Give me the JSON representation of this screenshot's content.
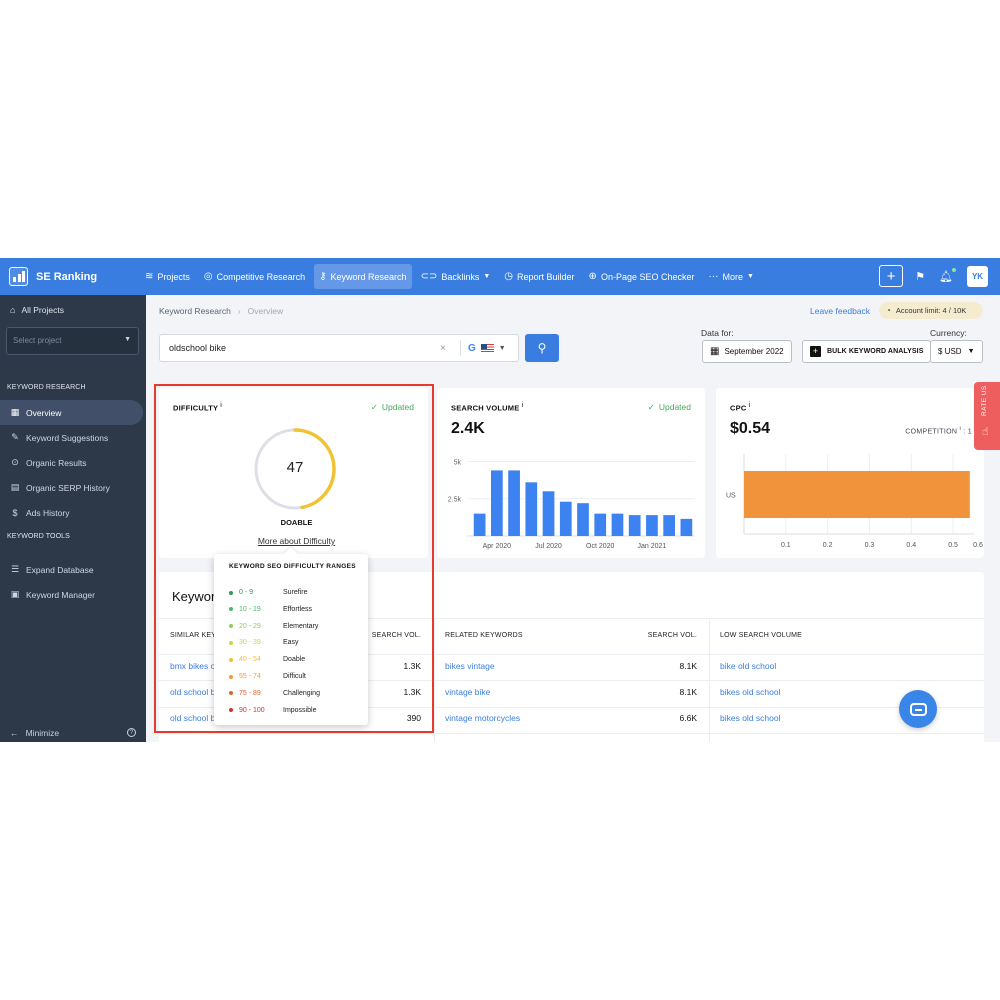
{
  "topbar": {
    "brand": "SE Ranking",
    "nav": [
      {
        "label": "Projects",
        "icon": "layers-icon"
      },
      {
        "label": "Competitive Research",
        "icon": "target-icon"
      },
      {
        "label": "Keyword Research",
        "icon": "key-icon"
      },
      {
        "label": "Backlinks",
        "icon": "link-icon"
      },
      {
        "label": "Report Builder",
        "icon": "clock-icon"
      },
      {
        "label": "On-Page SEO Checker",
        "icon": "search-icon"
      },
      {
        "label": "More",
        "icon": "dots-icon"
      }
    ],
    "avatar": "YK"
  },
  "sidebar": {
    "all_projects": "All Projects",
    "select_placeholder": "Select project",
    "section_research": "KEYWORD RESEARCH",
    "research_items": [
      "Overview",
      "Keyword Suggestions",
      "Organic Results",
      "Organic SERP History",
      "Ads History"
    ],
    "section_tools": "KEYWORD TOOLS",
    "tool_items": [
      "Expand Database",
      "Keyword Manager"
    ],
    "minimize": "Minimize"
  },
  "header": {
    "crumb_1": "Keyword Research",
    "crumb_2": "Overview",
    "feedback": "Leave feedback",
    "account_limit": "Account limit: 4 / 10K",
    "search_value": "oldschool bike",
    "data_for_label": "Data for:",
    "date_button": "September 2022",
    "bulk_button": "BULK KEYWORD ANALYSIS",
    "currency_label": "Currency:",
    "currency_value": "$ USD"
  },
  "difficulty": {
    "title": "DIFFICULTY",
    "status": "Updated",
    "value": "47",
    "score": 47,
    "label": "DOABLE",
    "more_link": "More about Difficulty"
  },
  "search_volume": {
    "title": "SEARCH VOLUME",
    "status": "Updated",
    "value": "2.4K"
  },
  "cpc": {
    "title": "CPC",
    "value": "$0.54",
    "competition_label": "COMPETITION",
    "competition_value": "1"
  },
  "chart_data": [
    {
      "type": "bar",
      "categories": [
        "",
        "",
        "",
        "",
        "",
        "",
        "",
        "",
        "",
        "",
        "",
        "",
        ""
      ],
      "values": [
        1500,
        4400,
        4400,
        3600,
        3000,
        2300,
        2200,
        1500,
        1500,
        1400,
        1400,
        1400,
        1150
      ],
      "x_tick_labels": [
        "Apr 2020",
        "Jul 2020",
        "Oct 2020",
        "Jan 2021"
      ],
      "y_tick_labels": [
        "5k",
        "2.5k"
      ],
      "ylim": [
        0,
        5500
      ],
      "bar_color": "#3c82f0"
    },
    {
      "type": "bar",
      "orientation": "horizontal",
      "categories": [
        "US"
      ],
      "values": [
        0.54
      ],
      "x_tick_labels": [
        "0.1",
        "0.2",
        "0.3",
        "0.4",
        "0.5",
        "0.6"
      ],
      "xlim": [
        0,
        0.55
      ],
      "bar_color": "#f0933a"
    }
  ],
  "keywords": {
    "title": "Keyword",
    "headers": {
      "similar": "SIMILAR KEY",
      "search_vol": "SEARCH VOL.",
      "related": "RELATED KEYWORDS",
      "low_volume": "LOW SEARCH VOLUME"
    },
    "rows": [
      {
        "similar": "bmx bikes o",
        "similar_vol": "1.3K",
        "related": "bikes vintage",
        "related_vol": "8.1K",
        "low": "bike old school"
      },
      {
        "similar": "old school b",
        "similar_vol": "1.3K",
        "related": "vintage bike",
        "related_vol": "8.1K",
        "low": "bikes old school"
      },
      {
        "similar": "old school b",
        "similar_vol": "390",
        "related": "vintage motorcycles",
        "related_vol": "6.6K",
        "low": "bikes old school"
      }
    ]
  },
  "tooltip": {
    "title": "KEYWORD SEO DIFFICULTY RANGES",
    "ranges": [
      {
        "range": "0 - 9",
        "label": "Surefire",
        "color": "#2e9a5a"
      },
      {
        "range": "10 - 19",
        "label": "Effortless",
        "color": "#4fb869"
      },
      {
        "range": "20 - 29",
        "label": "Elementary",
        "color": "#8ccf55"
      },
      {
        "range": "30 - 39",
        "label": "Easy",
        "color": "#c3d94a"
      },
      {
        "range": "40 - 54",
        "label": "Doable",
        "color": "#f1c232"
      },
      {
        "range": "55 - 74",
        "label": "Difficult",
        "color": "#f29a38"
      },
      {
        "range": "75 - 89",
        "label": "Challenging",
        "color": "#e0632f"
      },
      {
        "range": "90 - 100",
        "label": "Impossible",
        "color": "#c9372c"
      }
    ]
  },
  "rate_us": "RATE US",
  "colors": {
    "brand": "#3a7de0",
    "sidebar": "#2d3849",
    "highlight": "#e53b2c"
  }
}
